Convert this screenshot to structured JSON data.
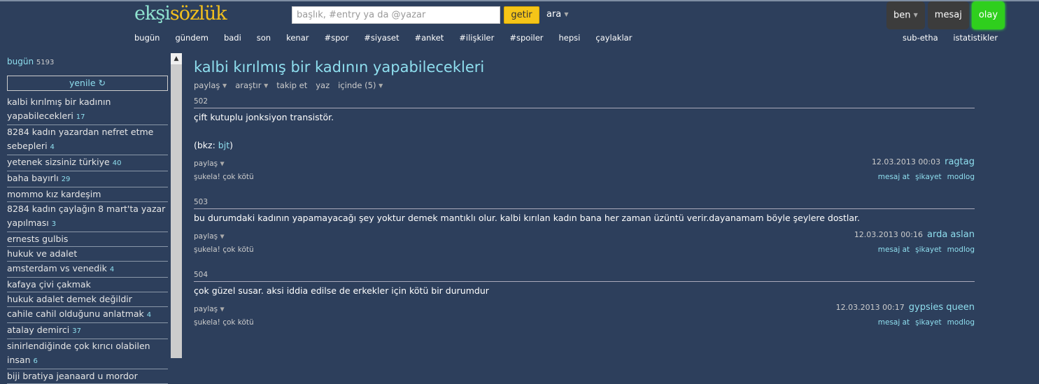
{
  "header": {
    "logo_part1": "ekşi",
    "logo_part2": "sözlük",
    "search_placeholder": "başlık, #entry ya da @yazar",
    "search_button": "getir",
    "ara": "ara",
    "nav": [
      "bugün",
      "gündem",
      "badi",
      "son",
      "kenar",
      "#spor",
      "#siyaset",
      "#anket",
      "#ilişkiler",
      "#spoiler",
      "hepsi",
      "çaylaklar"
    ],
    "user_buttons": [
      "ben",
      "mesaj",
      "olay"
    ],
    "sub_nav": [
      "sub-etha",
      "istatistikler"
    ],
    "accent": "#2fcf1d"
  },
  "sidebar": {
    "today_label": "bugün",
    "today_count": "5193",
    "refresh": "yenile ↻",
    "topics": [
      {
        "title": "kalbi kırılmış bir kadının yapabilecekleri",
        "count": "17"
      },
      {
        "title": "8284 kadın yazardan nefret etme sebepleri",
        "count": "4"
      },
      {
        "title": "yetenek sizsiniz türkiye",
        "count": "40"
      },
      {
        "title": "baha bayırlı",
        "count": "29"
      },
      {
        "title": "mommo kız kardeşim",
        "count": ""
      },
      {
        "title": "8284 kadın çaylağın 8 mart'ta yazar yapılması",
        "count": "3"
      },
      {
        "title": "ernests gulbis",
        "count": ""
      },
      {
        "title": "hukuk ve adalet",
        "count": ""
      },
      {
        "title": "amsterdam vs venedik",
        "count": "4"
      },
      {
        "title": "kafaya çivi çakmak",
        "count": ""
      },
      {
        "title": "hukuk adalet demek değildir",
        "count": ""
      },
      {
        "title": "cahile cahil olduğunu anlatmak",
        "count": "4"
      },
      {
        "title": "atalay demirci",
        "count": "37"
      },
      {
        "title": "sinirlendiğinde çok kırıcı olabilen insan",
        "count": "6"
      },
      {
        "title": "biji bratiya jeanaard u mordor",
        "count": ""
      }
    ]
  },
  "topic": {
    "title": "kalbi kırılmış bir kadının yapabilecekleri",
    "actions": [
      "paylaş",
      "araştır",
      "takip et",
      "yaz",
      "içinde (5)"
    ]
  },
  "entries": [
    {
      "num": "502",
      "text": "çift kutuplu jonksiyon transistör.",
      "extra_prefix": "(bkz: ",
      "extra_link": "bjt",
      "extra_suffix": ")",
      "date": "12.03.2013 00:03",
      "author": "ragtag"
    },
    {
      "num": "503",
      "text": "bu durumdaki kadının yapamayacağı şey yoktur demek mantıklı olur. kalbi kırılan kadın bana her zaman üzüntü verir.dayanamam böyle şeylere dostlar.",
      "date": "12.03.2013 00:16",
      "author": "arda aslan"
    },
    {
      "num": "504",
      "text": "çok güzel susar. aksi iddia edilse de erkekler için kötü bir durumdur",
      "date": "12.03.2013 00:17",
      "author": "gypsies queen"
    }
  ],
  "entry_labels": {
    "share": "paylaş",
    "vote": "şukela! çok kötü",
    "links": [
      "mesaj at",
      "şikayet",
      "modlog"
    ]
  }
}
